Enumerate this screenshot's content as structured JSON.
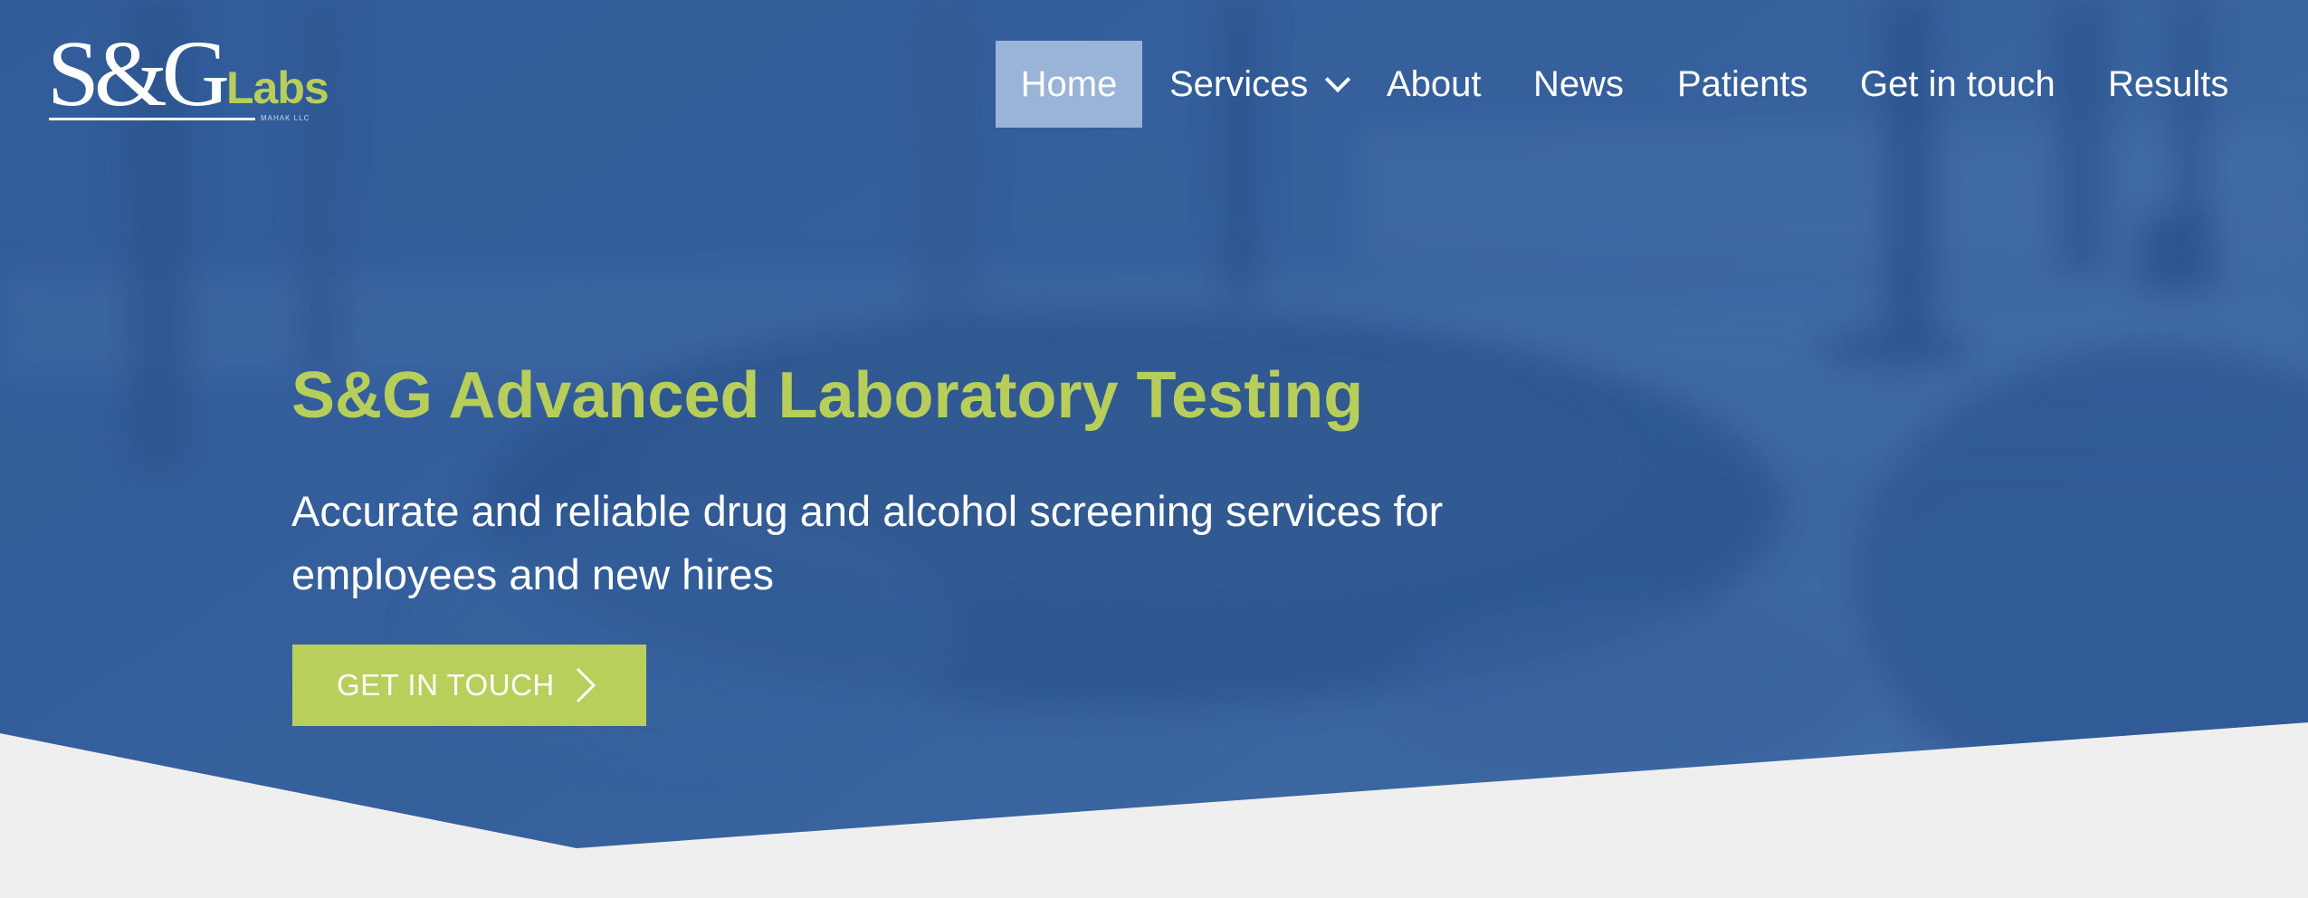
{
  "logo": {
    "main_text": "S&G",
    "labs_text": "Labs",
    "tagline": "MAHAK LLC"
  },
  "nav": {
    "items": [
      {
        "label": "Home",
        "active": true
      },
      {
        "label": "Services",
        "has_dropdown": true
      },
      {
        "label": "About"
      },
      {
        "label": "News"
      },
      {
        "label": "Patients"
      },
      {
        "label": "Get in touch"
      },
      {
        "label": "Results"
      }
    ]
  },
  "hero": {
    "title": "S&G Advanced Laboratory Testing",
    "subtitle": "Accurate and reliable drug and alcohol screening services for employees and new hires",
    "cta_label": "GET IN TOUCH"
  },
  "icons": {
    "nav_dropdown": "chevron-down-icon",
    "cta_arrow": "chevron-right-icon"
  },
  "colors": {
    "hero_overlay": "#3a64a0",
    "accent_green": "#b7cf5a",
    "nav_active_bg": "#99b4d6",
    "page_bg": "#efefef",
    "text_white": "#ffffff"
  }
}
